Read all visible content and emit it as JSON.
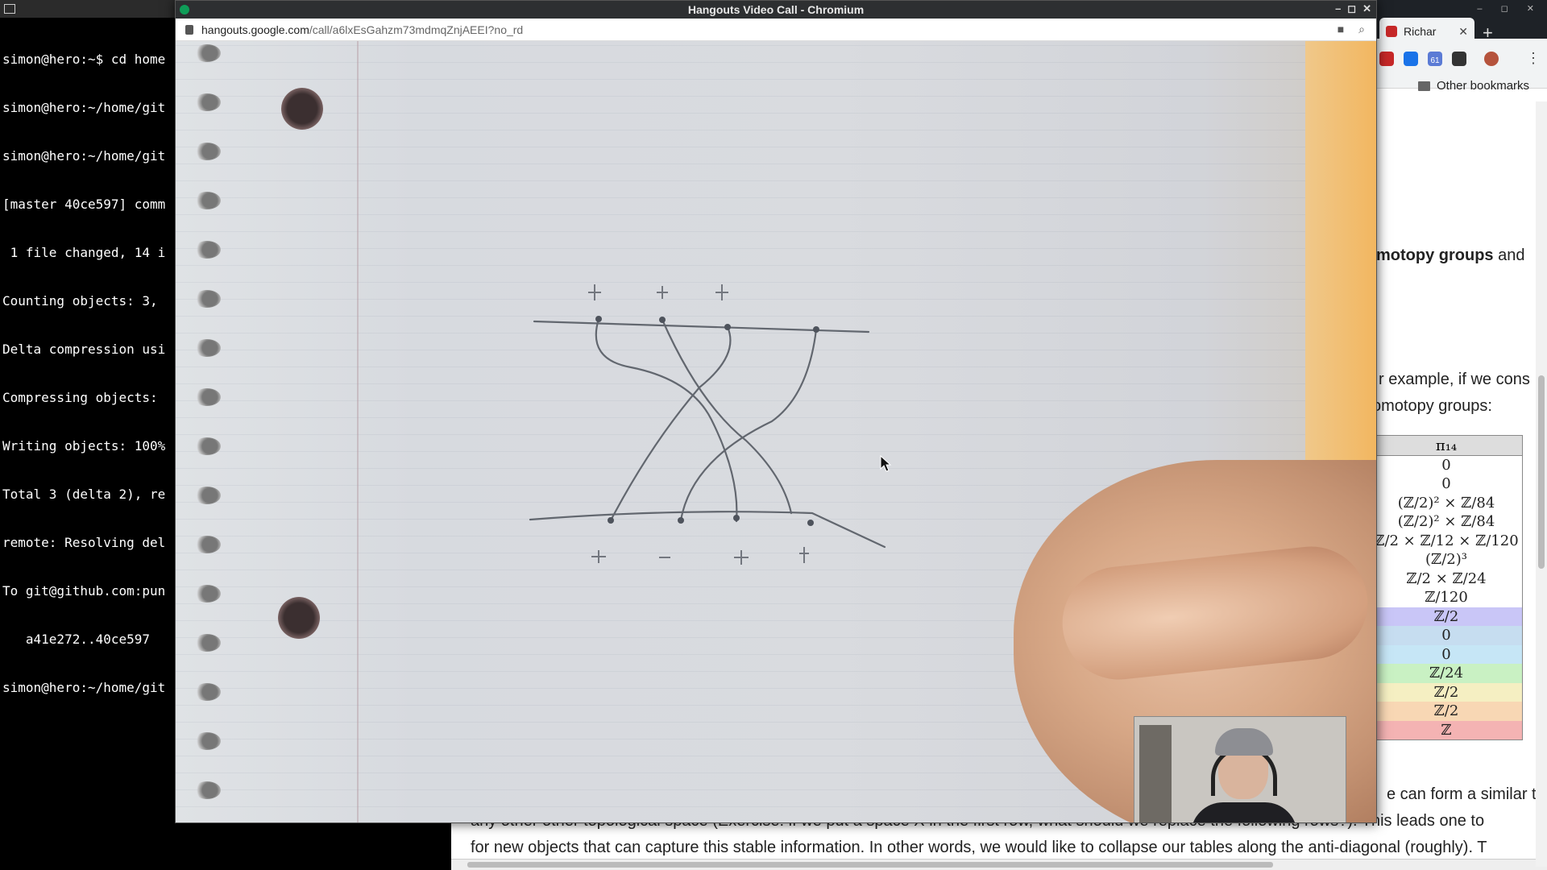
{
  "terminal": {
    "lines": [
      "simon@hero:~$ cd home",
      "simon@hero:~/home/git",
      "simon@hero:~/home/git",
      "[master 40ce597] comm",
      " 1 file changed, 14 i",
      "Counting objects: 3, ",
      "Delta compression usi",
      "Compressing objects: ",
      "Writing objects: 100%",
      "Total 3 (delta 2), re",
      "remote: Resolving del",
      "To git@github.com:pun",
      "   a41e272..40ce597  ",
      "simon@hero:~/home/git"
    ]
  },
  "browser": {
    "tab_title": "Richar",
    "bookmarks_label": "Other bookmarks",
    "extension_badge": "61"
  },
  "page": {
    "heading_fragment_bold": "motopy groups",
    "heading_fragment_rest": " and",
    "example_line": "r example, if we cons",
    "example_line2": "omotopy groups:",
    "table_header": "π₁₄",
    "table_rows": [
      {
        "value": "0",
        "color": "#ffffff"
      },
      {
        "value": "0",
        "color": "#ffffff"
      },
      {
        "value": "(ℤ/2)² × ℤ/84",
        "color": "#ffffff"
      },
      {
        "value": "(ℤ/2)² × ℤ/84",
        "color": "#ffffff"
      },
      {
        "value": "ℤ/2 × ℤ/12 × ℤ/120",
        "color": "#ffffff"
      },
      {
        "value": "(ℤ/2)³",
        "color": "#ffffff"
      },
      {
        "value": "ℤ/2 × ℤ/24",
        "color": "#ffffff"
      },
      {
        "value": "ℤ/120",
        "color": "#ffffff"
      },
      {
        "value": "ℤ/2",
        "color": "#c9c6f7"
      },
      {
        "value": "0",
        "color": "#c6ddf0"
      },
      {
        "value": "0",
        "color": "#c6e6f6"
      },
      {
        "value": "ℤ/24",
        "color": "#c9f1c3"
      },
      {
        "value": "ℤ/2",
        "color": "#f5efc2"
      },
      {
        "value": "ℤ/2",
        "color": "#f8d7b4"
      },
      {
        "value": "ℤ",
        "color": "#f4b3b3"
      }
    ],
    "right_line_after_table": "e can form a similar t",
    "bottom_line1": "any other other topological space (Exercise: if we put a space X in the first row, what should we replace the following rows?). This leads one to",
    "bottom_line2": "for new objects that can capture this stable information. In other words, we would like to collapse our tables along the anti-diagonal (roughly). T"
  },
  "call": {
    "window_title": "Hangouts Video Call - Chromium",
    "url_host": "hangouts.google.com",
    "url_path": "/call/a6lxEsGahzm73mdmqZnjAEEI?no_rd",
    "feed_description_icon": "video-camera-icon"
  }
}
